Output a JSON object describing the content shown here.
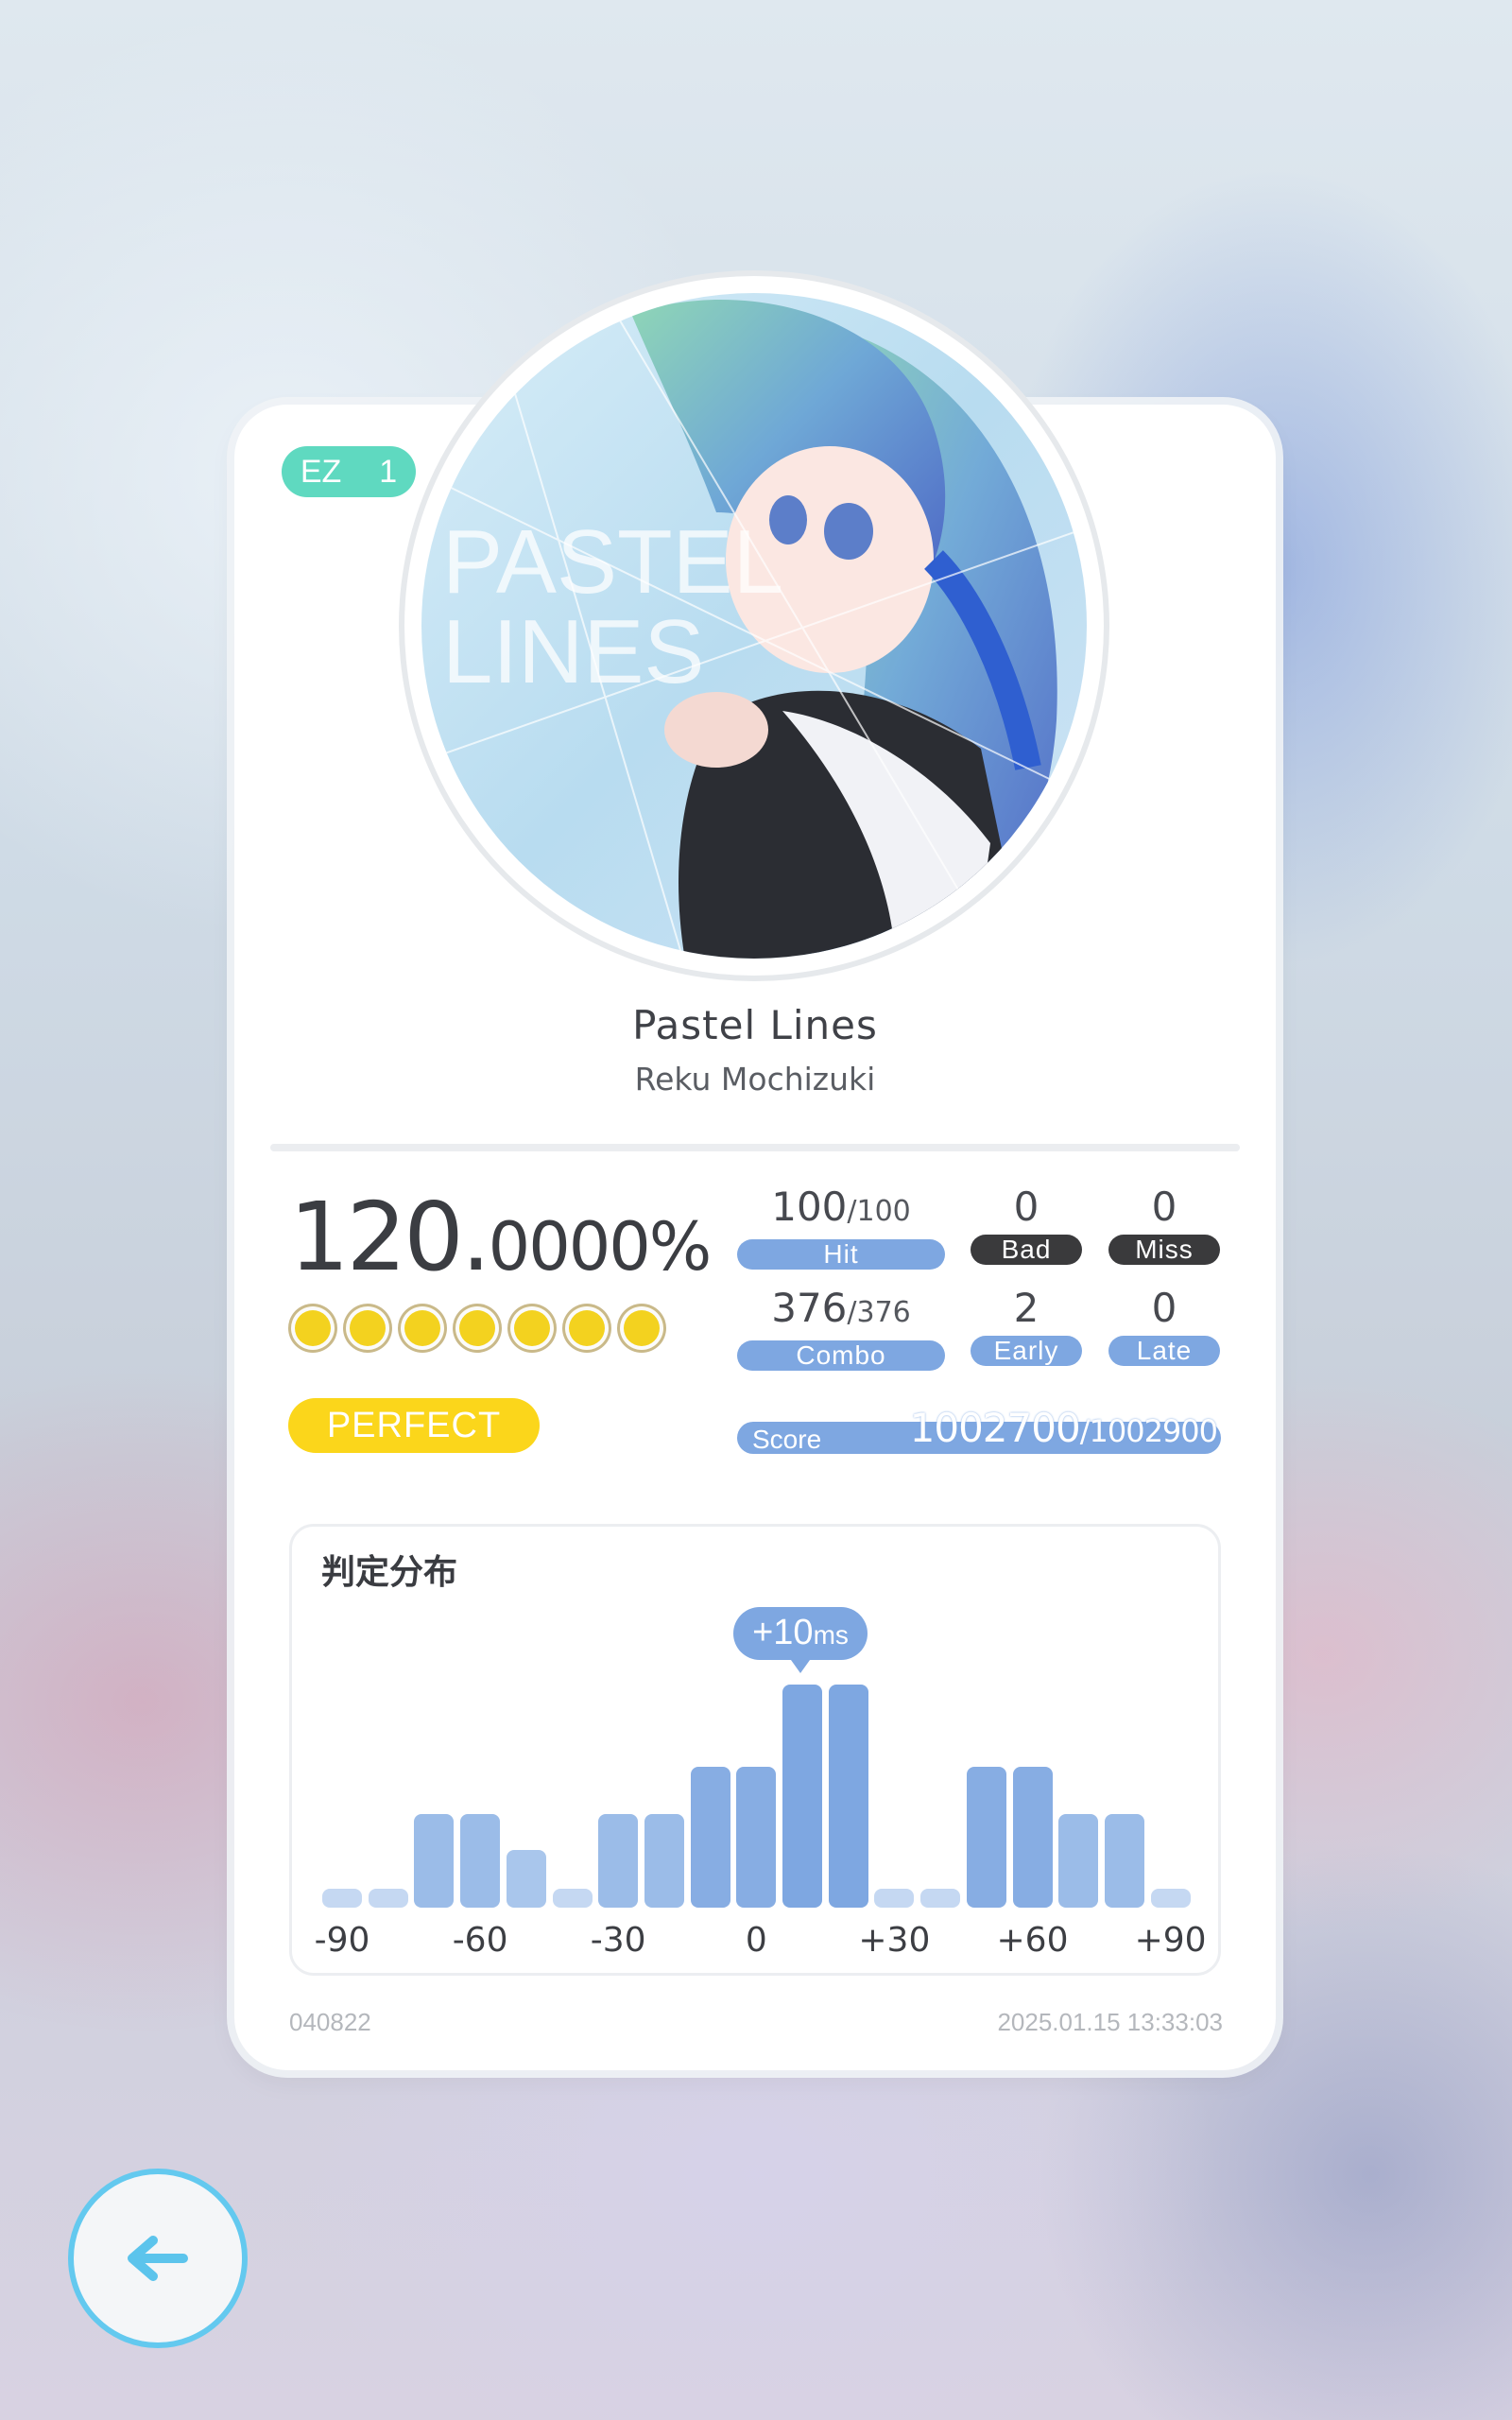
{
  "difficulty": {
    "name": "EZ",
    "level": "1"
  },
  "song": {
    "title": "Pastel Lines",
    "artist": "Reku Mochizuki",
    "jacket_text": [
      "PASTEL",
      "LINES"
    ]
  },
  "result": {
    "accuracy_int": "120.",
    "accuracy_dec": "0000%",
    "rank": "PERFECT",
    "circles": 7
  },
  "stats": {
    "hit": {
      "value": "100",
      "total": "/100",
      "label": "Hit"
    },
    "bad": {
      "value": "0",
      "label": "Bad"
    },
    "miss": {
      "value": "0",
      "label": "Miss"
    },
    "combo": {
      "value": "376",
      "total": "/376",
      "label": "Combo"
    },
    "early": {
      "value": "2",
      "label": "Early"
    },
    "late": {
      "value": "0",
      "label": "Late"
    },
    "score": {
      "label": "Score",
      "value": "1002700",
      "total": "/1002900"
    }
  },
  "distribution": {
    "title": "判定分布",
    "offset_value": "+10",
    "offset_unit": "ms",
    "tick_labels": [
      "-90",
      "-60",
      "-30",
      "0",
      "+30",
      "+60",
      "+90"
    ],
    "bins": [
      0.03,
      0.03,
      0.42,
      0.42,
      0.26,
      0.03,
      0.42,
      0.42,
      0.63,
      0.63,
      1.0,
      1.0,
      0.03,
      0.03,
      0.63,
      0.63,
      0.42,
      0.42,
      0.03
    ]
  },
  "footer": {
    "id": "040822",
    "datetime": "2025.01.15 13:33:03"
  },
  "colors": {
    "accent_blue": "#7ea7e1",
    "badge_teal": "#5fd9c0",
    "perfect_yellow": "#fbd61b",
    "dark_label": "#3a3a3c",
    "back_ring": "#63c9ef"
  },
  "icons": {
    "back": "arrow-left-icon"
  }
}
